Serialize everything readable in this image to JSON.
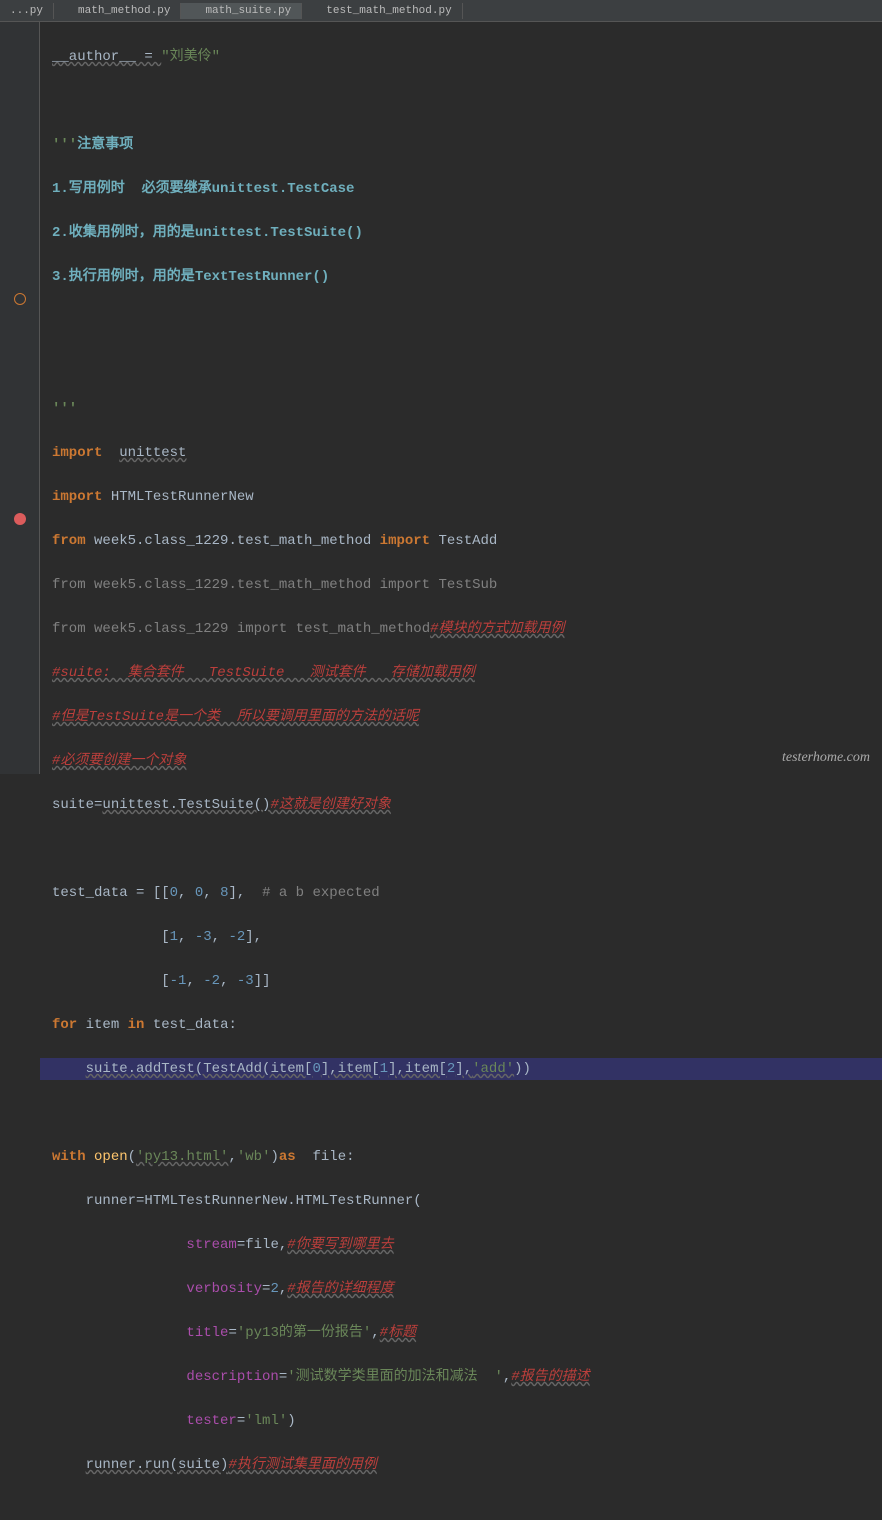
{
  "tabs": [
    {
      "name": "...py"
    },
    {
      "name": "math_method.py"
    },
    {
      "name": "math_suite.py",
      "active": true
    },
    {
      "name": "test_math_method.py"
    }
  ],
  "code": {
    "author_assign": "__author__ = ",
    "author_val": "\"刘美伶\"",
    "docstart": "'''",
    "doc_title": "注意事项",
    "doc1a": "1.写用例时  必须要继承",
    "doc1b": "unittest.TestCase",
    "doc2a": "2.收集用例时，用的是",
    "doc2b": "unittest.TestSuite()",
    "doc3a": "3.执行用例时，用的是",
    "doc3b": "TextTestRunner()",
    "docend": "'''",
    "imp": "import",
    "frm": "from",
    "unittest": "unittest",
    "htmlrunner": "HTMLTestRunnerNew",
    "week5a": "week5.class_1229.test_math_method",
    "week5b": "week5.class_1229",
    "testadd": "TestAdd",
    "testsub": "TestSub",
    "tmm": "test_math_method",
    "comment_module": "#模块的方式加载用例",
    "comment_suite1": "#suite:  集合套件   TestSuite   测试套件   存储加载用例",
    "comment_suite2": "#但是TestSuite是一个类  所以要调用里面的方法的话呢",
    "comment_suite3": "#必须要创建一个对象",
    "suite_eq": "suite=",
    "unittest_ts": "unittest.TestSuite()",
    "comment_obj": "#这就是创建好对象",
    "testdata": "test_data = [[",
    "z1": "0",
    "z2": "0",
    "z3": "8",
    "comment_abexp": "# a b expected",
    "row2a": "1",
    "row2b": "-3",
    "row2c": "-2",
    "row3a": "-1",
    "row3b": "-2",
    "row3c": "-3",
    "for": "for",
    "in": "in",
    "item": "item",
    "testdata_id": "test_data:",
    "suite_add": "suite.addTest(TestAdd(item[",
    "idx0": "0",
    "idx1": "1",
    "idx2": "2",
    "item_br": "],item[",
    "item_end": "],",
    "add_str": "'add'",
    "close_paren": "))",
    "with": "with",
    "open": "open",
    "py13": "'py13.html'",
    "wb": "'wb'",
    "as": "as",
    "file": "file:",
    "runner_eq": "runner=",
    "htr_new": "HTMLTestRunnerNew.HTMLTestRunner(",
    "p_stream": "stream",
    "eq_file": "=file,",
    "c_stream": "#你要写到哪里去",
    "p_verbosity": "verbosity",
    "eq2": "=",
    "v2": "2",
    "c_verbosity": "#报告的详细程度",
    "p_title": "title",
    "title_val": "'py13的第一份报告'",
    "c_title": "#标题",
    "p_desc": "description",
    "desc_val": "'测试数学类里面的加法和减法  '",
    "c_desc": "#报告的描述",
    "p_tester": "tester",
    "tester_val": "'lml'",
    "close_p": ")",
    "runner_run": "runner.run(suite)",
    "c_run": "#执行测试集里面的用例"
  },
  "watermark": "testerhome.com"
}
